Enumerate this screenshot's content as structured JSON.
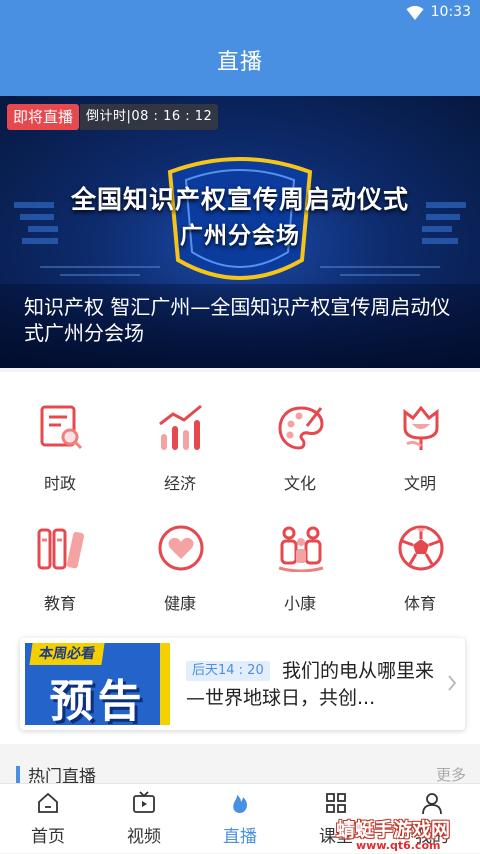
{
  "status_bar": {
    "time": "10:33"
  },
  "header": {
    "title": "直播"
  },
  "banner": {
    "live_badge": "即将直播",
    "countdown": "倒计时|08 : 16 : 12",
    "poster_line1": "全国知识产权宣传周启动仪式",
    "poster_line2": "广州分会场",
    "caption": "知识产权  智汇广州—全国知识产权宣传周启动仪式广州分会场"
  },
  "categories": [
    {
      "label": "时政",
      "icon": "document-search-icon"
    },
    {
      "label": "经济",
      "icon": "bar-chart-icon"
    },
    {
      "label": "文化",
      "icon": "palette-icon"
    },
    {
      "label": "文明",
      "icon": "tulip-icon"
    },
    {
      "label": "教育",
      "icon": "books-icon"
    },
    {
      "label": "健康",
      "icon": "heart-icon"
    },
    {
      "label": "小康",
      "icon": "family-icon"
    },
    {
      "label": "体育",
      "icon": "soccer-ball-icon"
    }
  ],
  "notice": {
    "poster_tag": "本周必看",
    "poster_title": "预告",
    "time_tag": "后天14 : 20",
    "title": "我们的电从哪里来—世界地球日，共创..."
  },
  "hot": {
    "title": "热门直播",
    "more": "更多"
  },
  "tabbar": [
    {
      "label": "首页",
      "icon": "home-icon"
    },
    {
      "label": "视频",
      "icon": "video-icon"
    },
    {
      "label": "直播",
      "icon": "flame-icon"
    },
    {
      "label": "课堂",
      "icon": "grid-icon"
    },
    {
      "label": "我的",
      "icon": "user-icon"
    }
  ],
  "watermark": {
    "name": "蜻蜓手游戏网",
    "url": "www.qt6.com"
  },
  "colors": {
    "primary": "#4a90e2",
    "accent_red": "#e5484d"
  }
}
